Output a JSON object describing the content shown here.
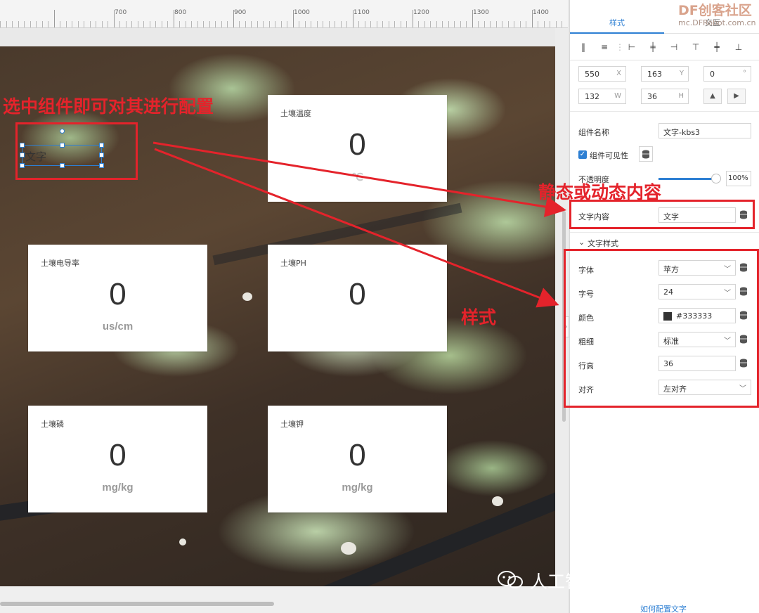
{
  "ruler": {
    "labels": [
      "700",
      "800",
      "900",
      "1000",
      "1100",
      "1200",
      "1300",
      "1400"
    ]
  },
  "panel": {
    "tabs": [
      "样式",
      "交互"
    ],
    "watermark": {
      "brand": "DF创客社区",
      "site": "mc.DFRobot.com.cn"
    },
    "geometry": {
      "x": "550",
      "x_suffix": "X",
      "y": "163",
      "y_suffix": "Y",
      "rotation": "0",
      "rotation_suffix": "°",
      "w": "132",
      "w_suffix": "W",
      "h": "36",
      "h_suffix": "H"
    },
    "component_name_label": "组件名称",
    "component_name_value": "文字-kbs3",
    "visibility_label": "组件可见性",
    "opacity_label": "不透明度",
    "opacity_value": "100%",
    "opacity_level": 1.0,
    "text_content_label": "文字内容",
    "text_content_value": "文字",
    "text_style_section": "文字样式",
    "font_label": "字体",
    "font_value": "苹方",
    "size_label": "字号",
    "size_value": "24",
    "color_label": "颜色",
    "color_value": "#333333",
    "weight_label": "粗细",
    "weight_value": "标准",
    "line_height_label": "行高",
    "line_height_value": "36",
    "align_label": "对齐",
    "align_value": "左对齐",
    "help_link": "如何配置文字"
  },
  "canvas": {
    "selected_text": "文字",
    "cards": [
      {
        "title": "土壤温度",
        "value": "0",
        "unit": "℃"
      },
      {
        "title": "土壤电导率",
        "value": "0",
        "unit": "us/cm"
      },
      {
        "title": "土壤PH",
        "value": "0",
        "unit": ""
      },
      {
        "title": "土壤磷",
        "value": "0",
        "unit": "mg/kg"
      },
      {
        "title": "土壤钾",
        "value": "0",
        "unit": "mg/kg"
      }
    ]
  },
  "annotations": {
    "select_hint": "选中组件即可对其进行配置",
    "content_hint": "静态或动态内容",
    "style_hint": "样式"
  },
  "footer_brand": "人工智能素养教育共同体",
  "colors": {
    "accent": "#2d7fd3",
    "annotation": "#e4232b",
    "text_color_swatch": "#333333"
  }
}
